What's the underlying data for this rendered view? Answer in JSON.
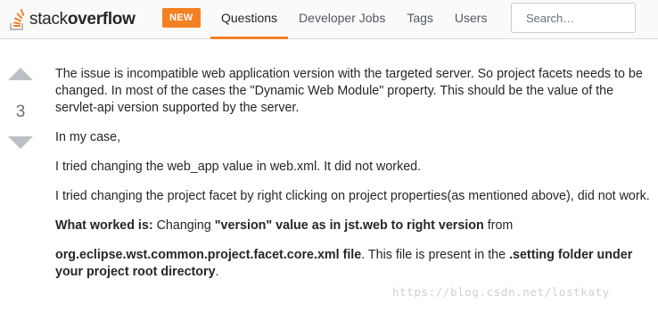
{
  "header": {
    "logo_light": "stack",
    "logo_bold": "overflow",
    "badge": "NEW",
    "nav": [
      {
        "label": "Questions",
        "active": true
      },
      {
        "label": "Developer Jobs",
        "active": false
      },
      {
        "label": "Tags",
        "active": false
      },
      {
        "label": "Users",
        "active": false
      }
    ],
    "search_placeholder": "Search…"
  },
  "vote": {
    "count": "3"
  },
  "answer": {
    "p1": "The issue is incompatible web application version with the targeted server. So project facets needs to be changed. In most of the cases the \"Dynamic Web Module\" property. This should be the value of the servlet-api version supported by the server.",
    "p2": "In my case,",
    "p3": "I tried changing the web_app value in web.xml. It did not worked.",
    "p4": "I tried changing the project facet by right clicking on project properties(as mentioned above), did not work.",
    "p5_bold1": "What worked is:",
    "p5_text1": " Changing ",
    "p5_bold2": "\"version\" value as in jst.web to right version",
    "p5_text2": " from",
    "p6_bold1": "org.eclipse.wst.common.project.facet.core.xml file",
    "p6_text1": ". This file is present in the ",
    "p6_bold2": ".setting folder under your project root directory",
    "p6_text2": "."
  },
  "watermark": "https://blog.csdn.net/lostkaty",
  "colors": {
    "accent": "#f48024",
    "arrow": "#bbc0c4"
  }
}
